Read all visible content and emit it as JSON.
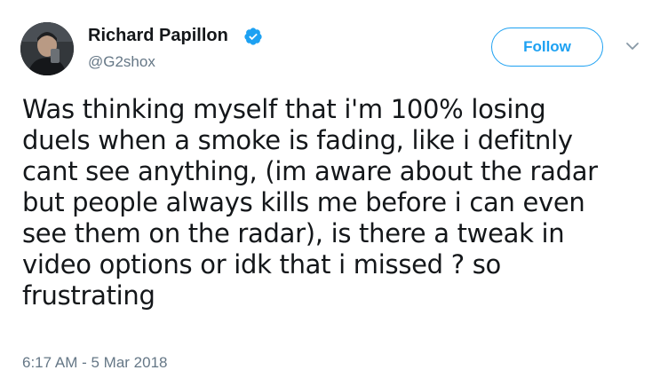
{
  "author": {
    "display_name": "Richard Papillon",
    "handle": "@G2shox",
    "verified": true,
    "verified_color": "#1da1f2",
    "avatar_icon": "profile-photo"
  },
  "follow_button": {
    "label": "Follow",
    "color": "#1da1f2"
  },
  "menu_icon": "chevron-down-icon",
  "tweet": {
    "lines": [
      "Was thinking myself that i'm 100% losing",
      "duels when a smoke is fading, like i defitnly",
      "cant see anything, (im aware about the radar",
      "but people always kills me before i can even",
      "see them on the radar), is there a tweak in",
      "video options or idk that i missed ? so",
      "frustrating"
    ],
    "timestamp": "6:17 AM - 5 Mar 2018"
  }
}
